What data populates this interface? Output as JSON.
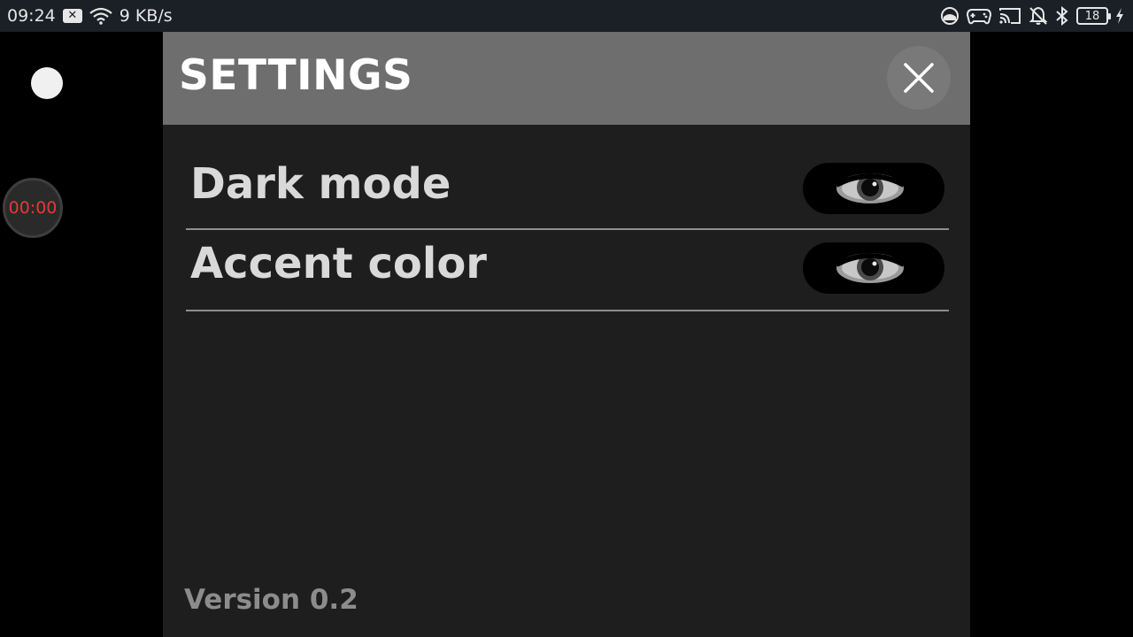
{
  "status_bar": {
    "time": "09:24",
    "notification_icon": "x-box-icon",
    "network_speed": "9 KB/s",
    "battery_level": "18",
    "icons": [
      "wifi-icon",
      "sync-icon",
      "gamepad-icon",
      "cast-icon",
      "bell-off-icon",
      "bluetooth-icon",
      "battery-icon",
      "charging-icon"
    ]
  },
  "overlay": {
    "recording_timer": "00:00",
    "timer_color": "#e53935"
  },
  "settings": {
    "title": "SETTINGS",
    "close_icon": "close-icon",
    "items": [
      {
        "label": "Dark mode",
        "toggle_icon": "eye-icon"
      },
      {
        "label": "Accent color",
        "toggle_icon": "eye-icon"
      }
    ],
    "version": "Version 0.2"
  },
  "colors": {
    "header_bg": "#6d6e6d",
    "panel_bg": "#1d1e1d",
    "status_bar_bg": "#1b1f26"
  }
}
